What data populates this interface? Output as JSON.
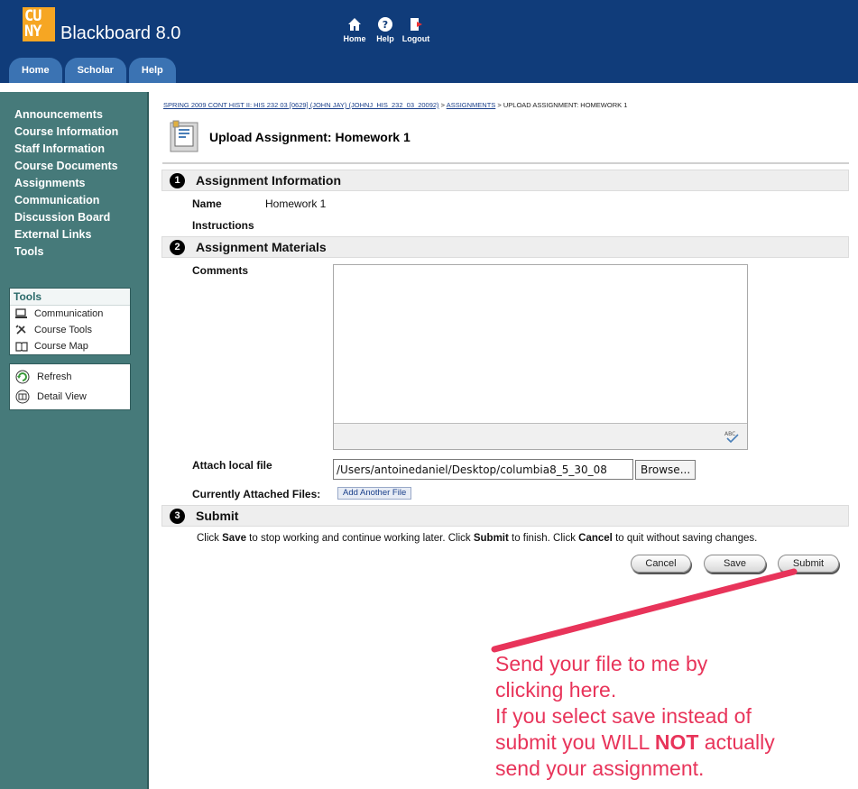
{
  "header": {
    "logo_line1": "CU",
    "logo_line2": "NY",
    "app_title": "Blackboard 8.0",
    "nav": [
      {
        "label": "Home",
        "icon": "home-icon"
      },
      {
        "label": "Help",
        "icon": "help-icon"
      },
      {
        "label": "Logout",
        "icon": "logout-icon"
      }
    ],
    "tabs": [
      "Home",
      "Scholar",
      "Help"
    ]
  },
  "sidebar": {
    "items": [
      "Announcements",
      "Course Information",
      "Staff Information",
      "Course Documents",
      "Assignments",
      "Communication",
      "Discussion Board",
      "External Links",
      "Tools"
    ],
    "tools_title": "Tools",
    "tools_items": [
      {
        "label": "Communication",
        "icon": "communication-icon"
      },
      {
        "label": "Course Tools",
        "icon": "course-tools-icon"
      },
      {
        "label": "Course Map",
        "icon": "course-map-icon"
      }
    ],
    "refresh_label": "Refresh",
    "detail_view_label": "Detail View"
  },
  "breadcrumb": {
    "course": "SPRING 2009 CONT HIST II: HIS 232 03 [0629] (JOHN JAY) (JOHNJ_HIS_232_03_20092)",
    "sep1": " > ",
    "assignments": "ASSIGNMENTS",
    "sep2": " > ",
    "current": "UPLOAD ASSIGNMENT: HOMEWORK 1"
  },
  "page_title": "Upload Assignment: Homework 1",
  "section1": {
    "num": "1",
    "title": "Assignment Information",
    "name_label": "Name",
    "name_value": "Homework 1",
    "instructions_label": "Instructions"
  },
  "section2": {
    "num": "2",
    "title": "Assignment Materials",
    "comments_label": "Comments",
    "attach_label": "Attach local file",
    "file_path": "/Users/antoinedaniel/Desktop/columbia8_5_30_08",
    "browse_label": "Browse...",
    "attached_label": "Currently Attached Files:",
    "add_file_label": "Add Another File"
  },
  "section3": {
    "num": "3",
    "title": "Submit",
    "instr_1": "Click ",
    "instr_save": "Save",
    "instr_2": " to stop working and continue working later. Click ",
    "instr_submit": "Submit",
    "instr_3": " to finish. Click ",
    "instr_cancel": "Cancel",
    "instr_4": " to quit without saving changes.",
    "cancel_label": "Cancel",
    "save_label": "Save",
    "submit_label": "Submit"
  },
  "annotation": {
    "line1": "Send your file to me by",
    "line2": "clicking here.",
    "line3": "If you select save instead of",
    "line4a": "submit you WILL ",
    "line4b": "NOT",
    "line4c": " actually",
    "line5": "send your assignment.",
    "color": "#e8345a"
  },
  "colors": {
    "header": "#103c7a",
    "tab": "#3b73b3",
    "sidebar": "#467a7a",
    "logo": "#f6a623"
  }
}
